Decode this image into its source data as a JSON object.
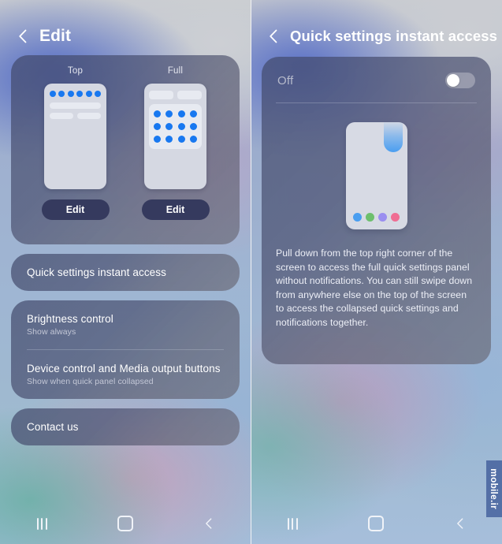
{
  "left_screen": {
    "header": {
      "back_icon": "chevron-left-icon",
      "title": "Edit"
    },
    "preview": {
      "options": [
        {
          "label": "Top",
          "edit_label": "Edit"
        },
        {
          "label": "Full",
          "edit_label": "Edit"
        }
      ],
      "dot_color": "#1878f0",
      "panel_color": "#d5d8e2"
    },
    "items": [
      {
        "primary": "Quick settings instant access",
        "secondary": ""
      },
      {
        "primary": "Brightness control",
        "secondary": "Show always"
      },
      {
        "primary": "Device control and Media output buttons",
        "secondary": "Show when quick panel collapsed"
      },
      {
        "primary": "Contact us",
        "secondary": ""
      }
    ]
  },
  "right_screen": {
    "header": {
      "back_icon": "chevron-left-icon",
      "title": "Quick settings instant access"
    },
    "toggle": {
      "label": "Off",
      "state": "off"
    },
    "illustration": {
      "swipe_corner_color": "#4a9ef0",
      "dots": [
        "#4a9ef0",
        "#6dbf6d",
        "#9a8ef0",
        "#ef6d93"
      ]
    },
    "description": "Pull down from the top right corner of the screen to access the full quick settings panel without notifications. You can still swipe down from anywhere else on the top of the screen to access the collapsed quick settings and notifications together."
  },
  "navbar": {
    "recents_label": "recents-icon",
    "home_label": "home-icon",
    "back_label": "back-icon"
  },
  "watermark": {
    "text": "mobile.ir"
  }
}
